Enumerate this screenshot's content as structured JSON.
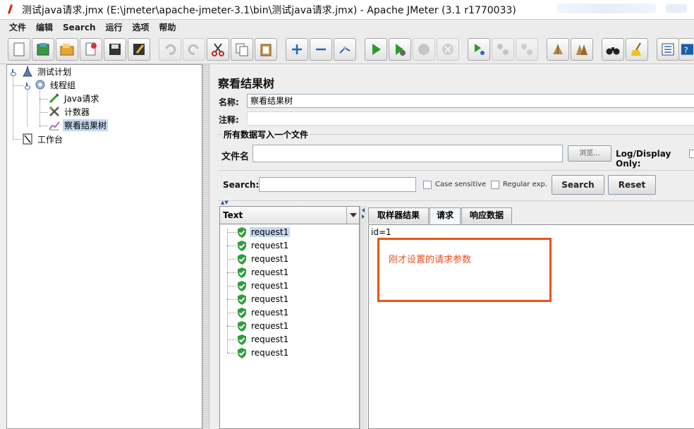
{
  "window": {
    "title": "测试java请求.jmx (E:\\jmeter\\apache-jmeter-3.1\\bin\\测试java请求.jmx) - Apache JMeter (3.1 r1770033)"
  },
  "menu": {
    "items": [
      "文件",
      "编辑",
      "Search",
      "运行",
      "选项",
      "帮助"
    ]
  },
  "toolbar": {
    "icons": [
      "new-icon",
      "templates-icon",
      "open-icon",
      "close-icon",
      "save-icon",
      "save-as-icon",
      "undo-icon",
      "redo-icon",
      "cut-icon",
      "copy-icon",
      "paste-icon",
      "expand-icon",
      "collapse-icon",
      "toggle-icon",
      "start-icon",
      "start-no-pause-icon",
      "stop-icon",
      "shutdown-icon",
      "remote-start-icon",
      "remote-stop-icon",
      "remote-shutdown-icon",
      "clear-icon",
      "clear-all-icon",
      "search-icon",
      "reset-search-icon",
      "function-helper-icon",
      "help-icon"
    ]
  },
  "tree": {
    "nodes": [
      {
        "label": "测试计划",
        "icon": "test-plan-icon"
      },
      {
        "label": "线程组",
        "icon": "thread-group-icon"
      },
      {
        "label": "Java请求",
        "icon": "java-sampler-icon"
      },
      {
        "label": "计数器",
        "icon": "counter-icon"
      },
      {
        "label": "察看结果树",
        "icon": "results-tree-icon"
      },
      {
        "label": "工作台",
        "icon": "workbench-icon"
      }
    ]
  },
  "panel": {
    "title": "察看结果树",
    "name_label": "名称:",
    "name_value": "察看结果树",
    "comment_label": "注释:",
    "comment_value": "",
    "file_group_title": "所有数据写入一个文件",
    "file_label": "文件名",
    "file_value": "",
    "browse_label": "浏览...",
    "log_display_label": "Log/Display Only:"
  },
  "search": {
    "label": "Search:",
    "value": "",
    "case_sensitive_label": "Case sensitive",
    "regex_label": "Regular exp.",
    "search_button": "Search",
    "reset_button": "Reset"
  },
  "results": {
    "renderer": "Text",
    "samples": [
      "request1",
      "request1",
      "request1",
      "request1",
      "request1",
      "request1",
      "request1",
      "request1",
      "request1",
      "request1"
    ],
    "tabs": [
      "取样器结果",
      "请求",
      "响应数据"
    ],
    "active_tab": "请求",
    "detail_text": "id=1",
    "annotation": "刚才设置的请求参数",
    "annotation_color": "#ea5414"
  }
}
